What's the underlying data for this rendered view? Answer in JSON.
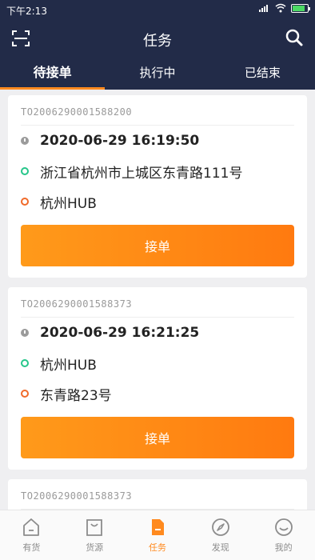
{
  "status_bar": {
    "time": "下午2:13"
  },
  "header": {
    "title": "任务"
  },
  "tabs": [
    {
      "label": "待接单",
      "active": true
    },
    {
      "label": "执行中",
      "active": false
    },
    {
      "label": "已结束",
      "active": false
    }
  ],
  "cards": [
    {
      "order_no": "TO2006290001588200",
      "time": "2020-06-29 16:19:50",
      "from": "浙江省杭州市上城区东青路111号",
      "to": "杭州HUB",
      "button": "接单"
    },
    {
      "order_no": "TO2006290001588373",
      "time": "2020-06-29 16:21:25",
      "from": "杭州HUB",
      "to": "东青路23号",
      "button": "接单"
    },
    {
      "order_no": "TO2006290001588373"
    }
  ],
  "bottom_nav": [
    {
      "label": "有货",
      "icon": "home-icon",
      "active": false
    },
    {
      "label": "货源",
      "icon": "bag-icon",
      "active": false
    },
    {
      "label": "任务",
      "icon": "task-icon",
      "active": true
    },
    {
      "label": "发现",
      "icon": "compass-icon",
      "active": false
    },
    {
      "label": "我的",
      "icon": "smile-icon",
      "active": false
    }
  ],
  "colors": {
    "header_bg": "#222b48",
    "accent": "#ff8a1f",
    "green": "#26c68a"
  }
}
